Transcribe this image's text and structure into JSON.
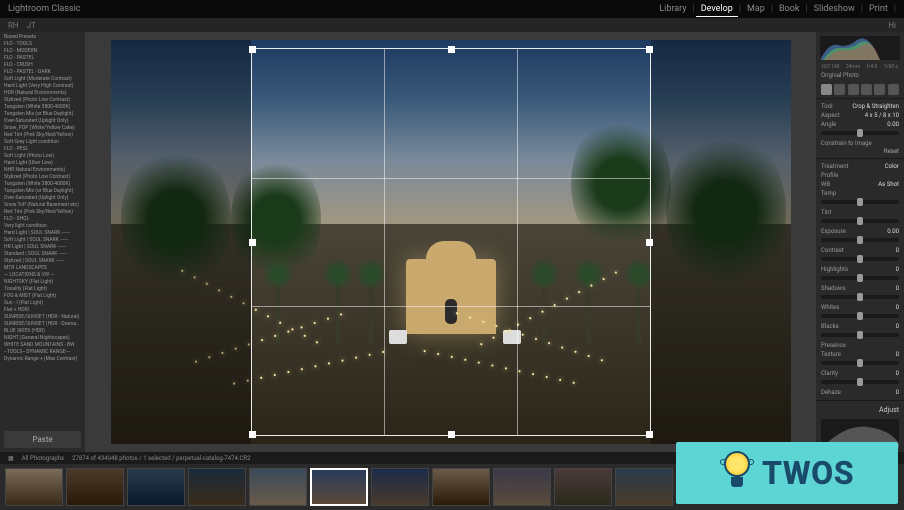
{
  "app": {
    "title": "Lightroom Classic"
  },
  "modules": [
    "Library",
    "Develop",
    "Map",
    "Book",
    "Slideshow",
    "Print"
  ],
  "active_module": "Develop",
  "sec_bar": {
    "left_items": [
      "RH",
      "JT"
    ],
    "right_label": "Hi"
  },
  "presets": {
    "items": [
      "Boxed Presets",
      "FLO - TOOLS",
      "FLO - MODERN",
      "FLO - PASTEL",
      "FLO - CRUSH",
      "FLO - PASTEL - DARK",
      "Soft Light (Moderate Contrast)",
      "Hard Light (Very High Contrast)",
      "HDR (Natural Environments)",
      "Stylized (Photo Low Contrast)",
      "Tungsten (White 3800-4000K)",
      "Tungsten Mix (or Blue Daylight)",
      "Over-Saturated (Uplight Only)",
      "Snow_POP (White/Yellow Cake)",
      "Red Tint (Pink Sky/Red/Yellow)",
      "Soft-Grey Light condition",
      "FLO - PESL",
      "Soft Light (Photo Low)",
      "Hard Light (Uber Low)",
      "NHR Natural Environments)",
      "Stylized (Photo Low Contrast)",
      "Tungsten (White 3800-4000K)",
      "Tungsten Mix (or Blue Daylight)",
      "Over-Saturated (Uplight Only)",
      "Snow TnP (Natural Basement etc)",
      "Red Tint (Pink Sky/Red/Yellow)",
      "FLO - SHQL",
      "Very light condition",
      "Hard Light | SOUL SNARK ------",
      "Soft Light | SOUL SNARK ------",
      "HR Light | SOUL SNARK ------",
      "Standard | SOUL SNARK ------",
      "Stylized | SOUL SNARK ------",
      "MTR LANDSCAPES",
      "--- LOCATIONS & VW ---",
      "NIGHTSKY (Flat Light)",
      "Tonality (Flat Light)",
      "FOG & MIST (Flat Light)",
      "Sun - I (Flat Light)",
      "Flat + HDRI",
      "SUNRISE/SUNSET (HDR - Natural)",
      "SUNRISE/SUNSET (HDR - Dramatic)",
      "BLUE SKIES (HDR)",
      "NIGHT (General Nightscapes)",
      "WHITE SAND MOUNTAINS - BW",
      "--TOOLS-- DYNAMIC RANGE---",
      "Dynamic Range + (Max Contrast)"
    ],
    "button_label": "Paste"
  },
  "right_panel": {
    "hist_labels": [
      "ISO 140",
      "24mm",
      "f/4.0",
      "1/60 s"
    ],
    "original_label": "Original Photo",
    "crop": {
      "tool_label": "Tool",
      "section_title": "Crop & Straighten",
      "aspect_label": "Aspect",
      "aspect_value": "4 x 5 / 8 x 10",
      "angle_label": "Angle",
      "angle_value": "0.00",
      "constrain_label": "Constrain to Image",
      "reset_label": "Reset"
    },
    "basic": {
      "treatment_label": "Treatment",
      "color_label": "Color",
      "profile_label": "Profile",
      "wb_label": "WB",
      "wb_value": "As Shot",
      "temp_label": "Temp",
      "tint_label": "Tint",
      "exposure_label": "Exposure",
      "exposure_value": "0.00",
      "contrast_label": "Contrast",
      "contrast_value": "0",
      "highlights_label": "Highlights",
      "highlights_value": "0",
      "shadows_label": "Shadows",
      "shadows_value": "0",
      "whites_label": "Whites",
      "whites_value": "0",
      "blacks_label": "Blacks",
      "blacks_value": "0",
      "presence_label": "Presence",
      "texture_label": "Texture",
      "texture_value": "0",
      "clarity_label": "Clarity",
      "clarity_value": "0",
      "dehaze_label": "Dehaze",
      "dehaze_value": "0"
    },
    "adjust_label": "Adjust"
  },
  "filmstrip": {
    "source_label": "All Photographs",
    "count_label": "27874 of 434048 photos / 1 selected / perpetual-catalog-7474.CR2",
    "thumbs": [
      {
        "bg": "linear-gradient(#7a6a5a,#3a2a1a)"
      },
      {
        "bg": "linear-gradient(#4a3a2a,#2a1a0a)"
      },
      {
        "bg": "linear-gradient(#2a3a4a,#0a1a2a)"
      },
      {
        "bg": "linear-gradient(#1a2a3a,#3a2a1a)"
      },
      {
        "bg": "linear-gradient(#3a4a5a,#6a5a4a)"
      },
      {
        "bg": "linear-gradient(#2a3a5a,#5a4a3a)",
        "selected": true
      },
      {
        "bg": "linear-gradient(#1a2a4a,#4a3a2a)"
      },
      {
        "bg": "linear-gradient(#6a5a4a,#2a1a0a)"
      },
      {
        "bg": "linear-gradient(#3a3a4a,#5a4a3a)"
      },
      {
        "bg": "linear-gradient(#4a3a3a,#2a2a1a)"
      },
      {
        "bg": "linear-gradient(#2a3a4a,#4a3a2a)"
      }
    ]
  },
  "watermark": {
    "text": "TWOS"
  }
}
